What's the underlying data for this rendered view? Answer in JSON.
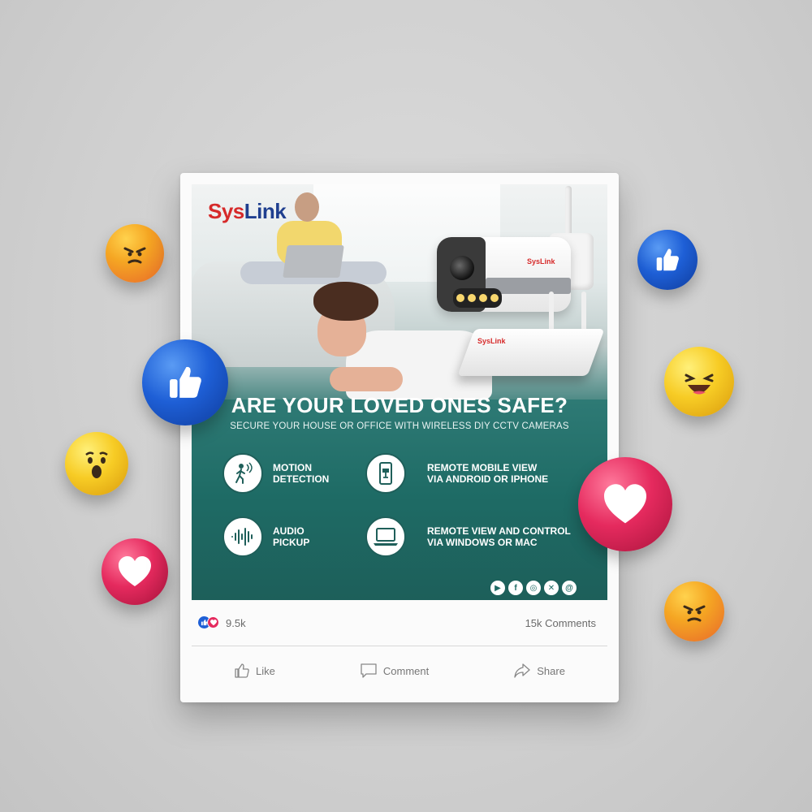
{
  "brand": {
    "sys": "Sys",
    "link": "Link",
    "camera_brand": "SysLink",
    "nvr_brand": "SysLink"
  },
  "ad": {
    "headline": "ARE YOUR LOVED ONES SAFE?",
    "subheadline": "SECURE YOUR HOUSE OR OFFICE WITH WIRELESS DIY CCTV CAMERAS",
    "features": [
      {
        "line1": "MOTION",
        "line2": "DETECTION",
        "icon": "motion-detection-icon"
      },
      {
        "line1": "REMOTE MOBILE VIEW",
        "line2": "VIA ANDROID OR IPHONE",
        "icon": "mobile-camera-icon"
      },
      {
        "line1": "AUDIO",
        "line2": "PICKUP",
        "icon": "audio-wave-icon"
      },
      {
        "line1": "REMOTE VIEW AND CONTROL",
        "line2": "VIA WINDOWS OR MAC",
        "icon": "laptop-icon"
      }
    ],
    "socials": [
      "youtube-icon",
      "facebook-icon",
      "instagram-icon",
      "x-icon",
      "threads-icon"
    ]
  },
  "post": {
    "reaction_count": "9.5k",
    "comment_count": "15k Comments",
    "actions": {
      "like": "Like",
      "comment": "Comment",
      "share": "Share"
    }
  },
  "colors": {
    "teal": "#1e6b65",
    "brand_red": "#d62a2a",
    "brand_blue": "#1f3f8f",
    "like_blue": "#1e5fd6",
    "love_pink": "#e52a5e"
  }
}
